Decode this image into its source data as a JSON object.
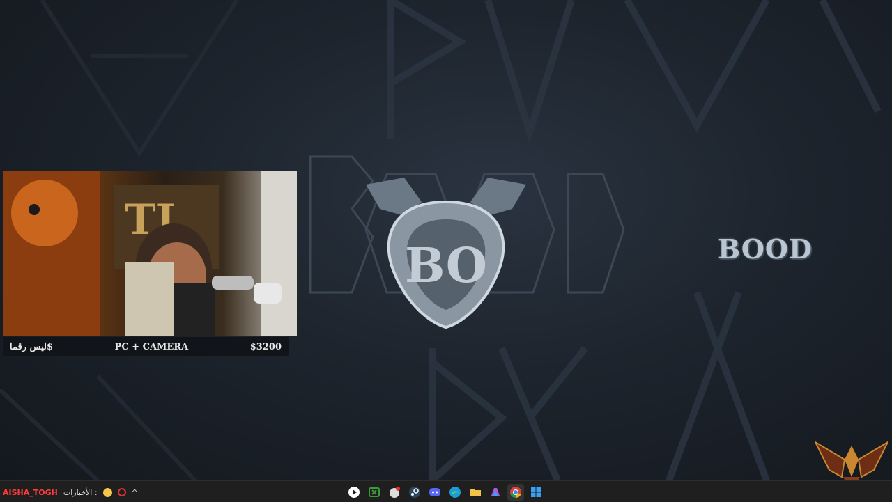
{
  "webcam": {
    "left_label": "ليس رقما$",
    "center_label": "PC + CAMERA",
    "right_label": "$3200"
  },
  "brand": {
    "name": "BOOD",
    "logo_letters": "BO"
  },
  "taskbar": {
    "ticker_label": "الأخبارات :",
    "ticker_user": "AISHA_TOGH",
    "caret": "^",
    "apps": [
      "media-player-icon",
      "xbox-icon",
      "game-icon",
      "steam-icon",
      "discord-icon",
      "edge-icon",
      "file-explorer-icon",
      "copilot-icon",
      "chrome-icon",
      "windows-icon"
    ]
  },
  "colors": {
    "taskbar": "#1f1f1f",
    "cam_bar": "#11151a",
    "brand_text": "#b9c6d2"
  }
}
